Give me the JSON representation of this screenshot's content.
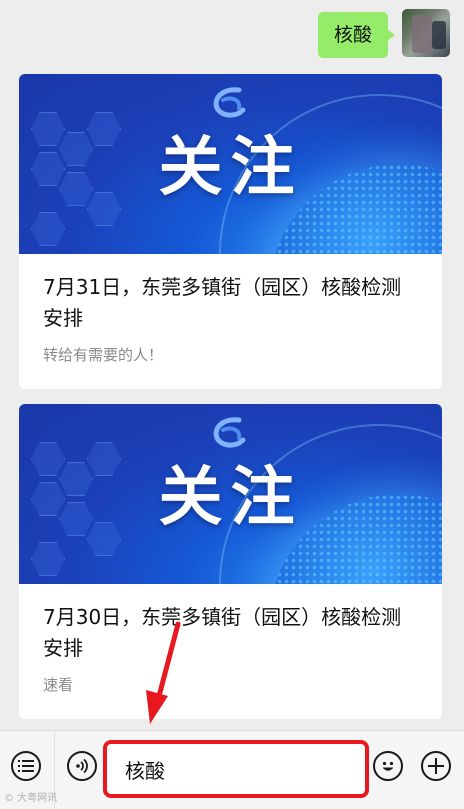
{
  "chat": {
    "outgoing_message": "核酸"
  },
  "articles": [
    {
      "cover_headline": "关注",
      "title": "7月31日，东莞多镇街（园区）核酸检测安排",
      "subtitle": "转给有需要的人！"
    },
    {
      "cover_headline": "关注",
      "title": "7月30日，东莞多镇街（园区）核酸检测安排",
      "subtitle": "速看"
    }
  ],
  "input_bar": {
    "text_value": "核酸",
    "icons": [
      "menu-icon",
      "voice-icon",
      "emoji-icon",
      "plus-icon"
    ]
  },
  "watermark": "© 大粤网讯",
  "colors": {
    "bubble": "#95ec69",
    "highlight": "#e8191e",
    "cover_blue": "#1b40b8"
  }
}
